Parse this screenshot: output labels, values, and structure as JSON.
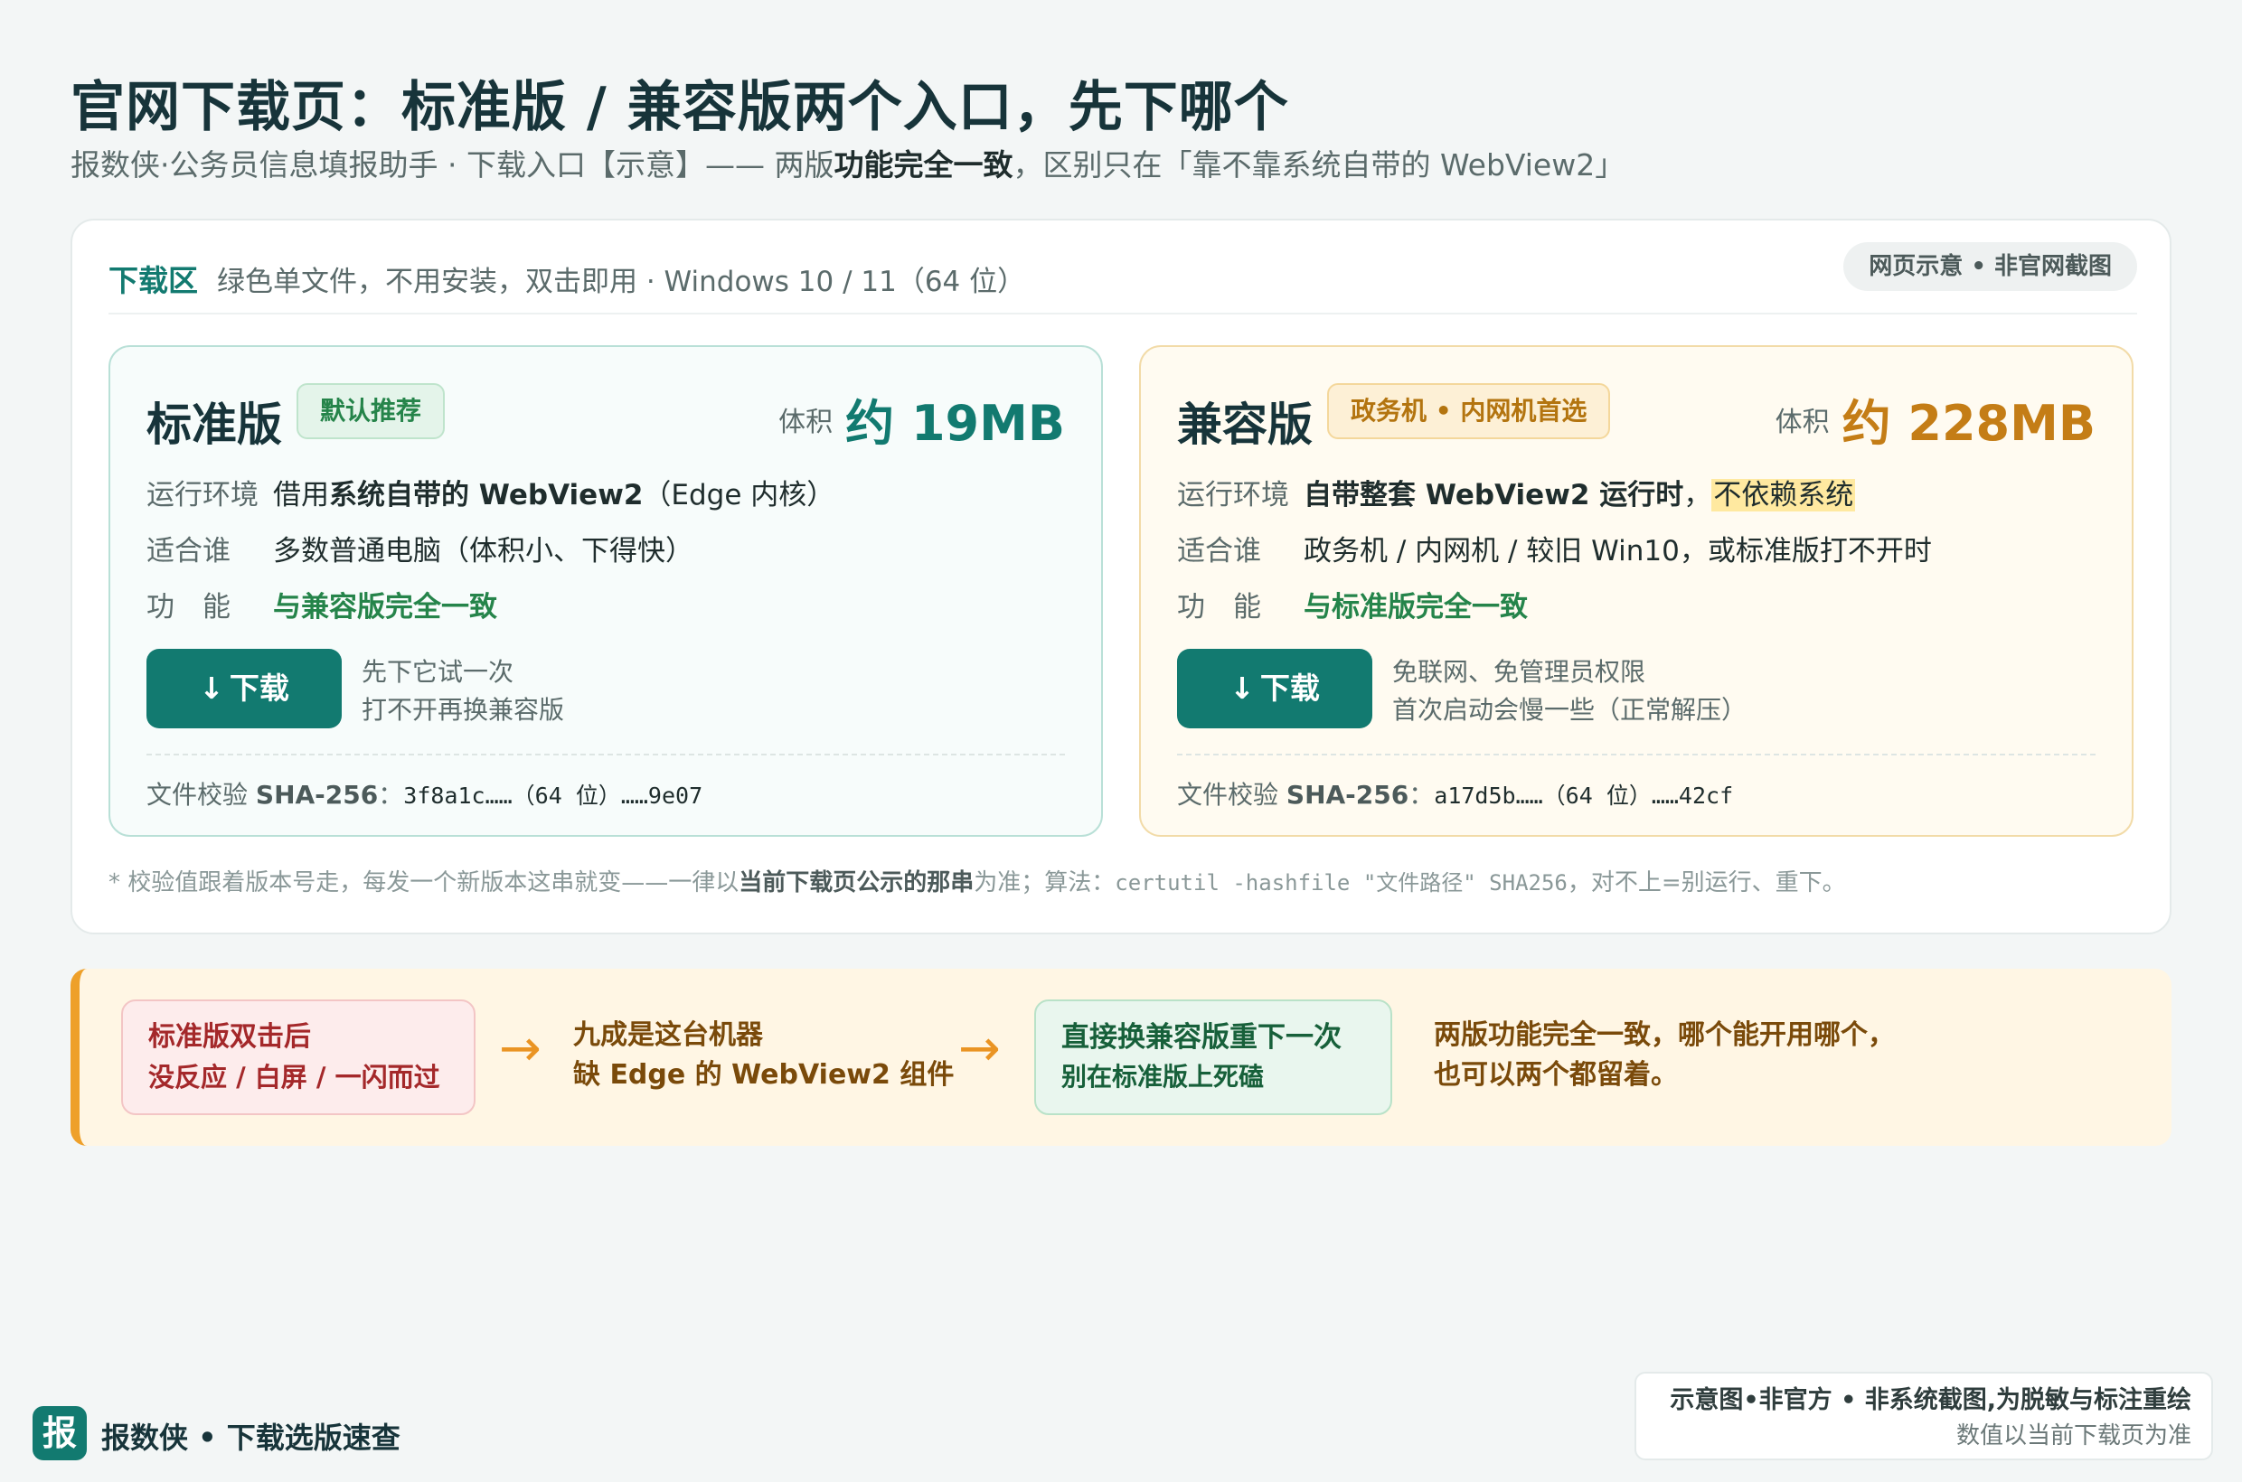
{
  "page": {
    "title": "官网下载页：标准版 / 兼容版两个入口，先下哪个",
    "subtitle_pre": "报数侠·公务员信息填报助手 · 下载入口【示意】—— 两版",
    "subtitle_bold": "功能完全一致",
    "subtitle_post": "，区别只在「靠不靠系统自带的 WebView2」"
  },
  "download_area": {
    "title": "下载区",
    "description": "绿色单文件，不用安装，双击即用 · Windows 10 / 11（64 位）",
    "badge": "网页示意 • 非官网截图",
    "footnote_pre": "* 校验值跟着版本号走，每发一个新版本这串就变——一律以",
    "footnote_bold": "当前下载页公示的那串",
    "footnote_mid": "为准；算法：",
    "footnote_cmd": "certutil -hashfile \"文件路径\" SHA256",
    "footnote_post": "，对不上=别运行、重下。"
  },
  "standard": {
    "name": "标准版",
    "badge": "默认推荐",
    "size_label": "体积",
    "size_value": "约 19MB",
    "env_label": "运行环境",
    "env_pre": "借用",
    "env_bold": "系统自带的 WebView2",
    "env_post": "（Edge 内核）",
    "who_label": "适合谁",
    "who_value": "多数普通电脑（体积小、下得快）",
    "func_label": "功　能",
    "func_value": "与兼容版完全一致",
    "button_icon": "↓",
    "button_label": "下载",
    "note1": "先下它试一次",
    "note2": "打不开再换兼容版",
    "checksum_label": "文件校验 ",
    "checksum_algo": "SHA-256",
    "checksum_sep": "：",
    "checksum_value": "3f8a1c……（64 位）……9e07"
  },
  "compat": {
    "name": "兼容版",
    "badge": "政务机 • 内网机首选",
    "size_label": "体积",
    "size_value": "约 228MB",
    "env_label": "运行环境",
    "env_bold": "自带整套 WebView2 运行时",
    "env_sep": "，",
    "env_highlight": "不依赖系统",
    "who_label": "适合谁",
    "who_value": "政务机 / 内网机 / 较旧 Win10，或标准版打不开时",
    "func_label": "功　能",
    "func_value": "与标准版完全一致",
    "button_icon": "↓",
    "button_label": "下载",
    "note1": "免联网、免管理员权限",
    "note2": "首次启动会慢一些（正常解压）",
    "checksum_label": "文件校验 ",
    "checksum_algo": "SHA-256",
    "checksum_sep": "：",
    "checksum_value": "a17d5b……（64 位）……42cf"
  },
  "flow": {
    "step1_l1": "标准版双击后",
    "step1_l2": "没反应 / 白屏 / 一闪而过",
    "arrow": "→",
    "step2_l1": "九成是这台机器",
    "step2_l2": "缺 Edge 的 WebView2 组件",
    "step3_l1": "直接换兼容版重下一次",
    "step3_l2": "别在标准版上死磕",
    "step4_l1": "两版功能完全一致，哪个能开用哪个，",
    "step4_l2": "也可以两个都留着。"
  },
  "footer": {
    "logo_char": "报",
    "brand": "报数侠 • 下载选版速查",
    "disclaimer_l1": "示意图•非官方 • 非系统截图,为脱敏与标注重绘",
    "disclaimer_l2": "数值以当前下载页为准"
  },
  "colors": {
    "accent": "#127a70",
    "warning": "#c47d16",
    "success": "#25844a",
    "danger": "#a4282a"
  }
}
